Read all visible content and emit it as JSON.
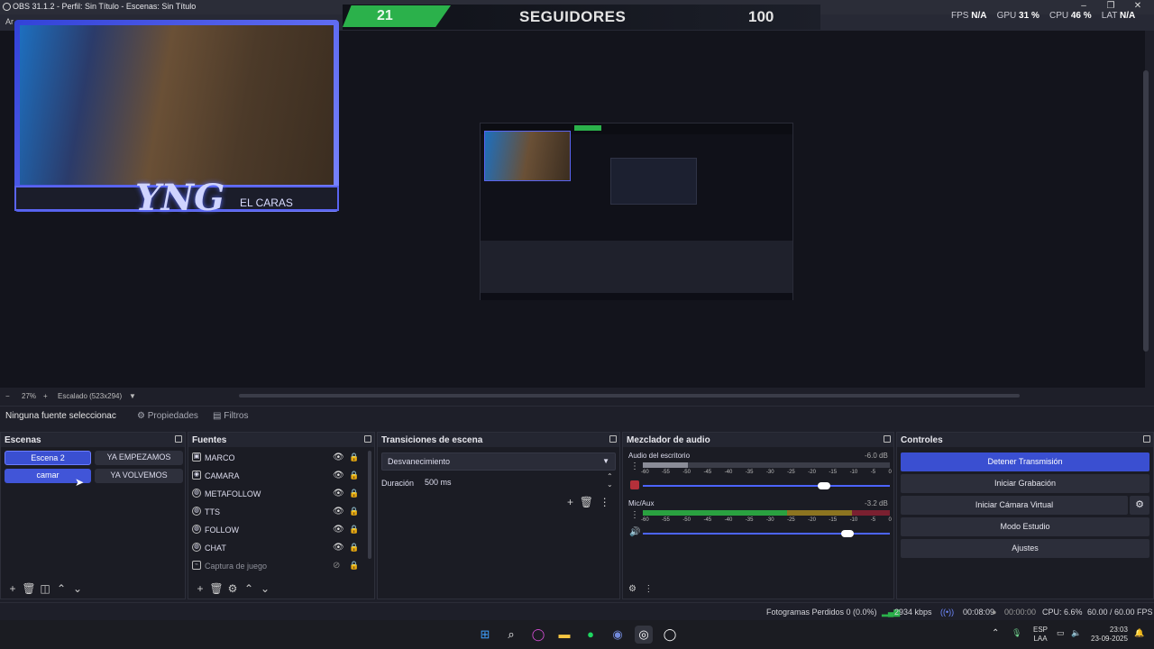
{
  "window": {
    "title": "OBS 31.1.2 - Perfil: Sin Título - Escenas: Sin Título",
    "menu_hint": "Ar"
  },
  "overlay": {
    "counter": "21",
    "label": "SEGUIDORES",
    "goal": "100"
  },
  "stats": {
    "fps_label": "FPS",
    "fps": "N/A",
    "gpu_label": "GPU",
    "gpu": "31 %",
    "cpu_label": "CPU",
    "cpu": "46 %",
    "lat_label": "LAT",
    "lat": "N/A"
  },
  "preview": {
    "logo": "YNG",
    "tagline": "EL CARAS"
  },
  "zoom": {
    "minus": "−",
    "value": "27%",
    "plus": "+",
    "scale_label": "Escalado (523x294)"
  },
  "properties": {
    "no_source": "Ninguna fuente seleccionac",
    "props_label": "Propiedades",
    "filters_label": "Filtros"
  },
  "scenes": {
    "title": "Escenas",
    "items": [
      "Escena 2",
      "YA EMPEZAMOS",
      "camar",
      "YA VOLVEMOS"
    ]
  },
  "sources": {
    "title": "Fuentes",
    "items": [
      "MARCO",
      "CAMARA",
      "METAFOLLOW",
      "TTS",
      "FOLLOW",
      "CHAT",
      "Captura de juego"
    ]
  },
  "transitions": {
    "title": "Transiciones de escena",
    "type": "Desvanecimiento",
    "duration_label": "Duración",
    "duration": "500 ms"
  },
  "mixer": {
    "title": "Mezclador de audio",
    "channels": [
      {
        "name": "Audio del escritorio",
        "db": "-6.0 dB",
        "volume": 0.76
      },
      {
        "name": "Mic/Aux",
        "db": "-3.2 dB",
        "volume": 0.84
      }
    ],
    "scale": [
      "-60",
      "-55",
      "-50",
      "-45",
      "-40",
      "-35",
      "-30",
      "-25",
      "-20",
      "-15",
      "-10",
      "-5",
      "0"
    ]
  },
  "controls": {
    "title": "Controles",
    "stop_stream": "Detener Transmisión",
    "start_record": "Iniciar Grabación",
    "virtual_cam": "Iniciar Cámara Virtual",
    "studio_mode": "Modo Estudio",
    "settings": "Ajustes"
  },
  "status": {
    "dropped": "Fotogramas Perdidos 0 (0.0%)",
    "bitrate": "2934 kbps",
    "stream_time": "00:08:09",
    "rec_time": "00:00:00",
    "cpu": "CPU: 6.6%",
    "fps": "60.00 / 60.00 FPS"
  },
  "taskbar": {
    "lang": "ESP",
    "lang2": "LAA",
    "time": "23:03",
    "date": "23-09-2025"
  },
  "colors": {
    "accent": "#3a4fd1",
    "green": "#2bb14b",
    "panel": "#1b1c24"
  }
}
